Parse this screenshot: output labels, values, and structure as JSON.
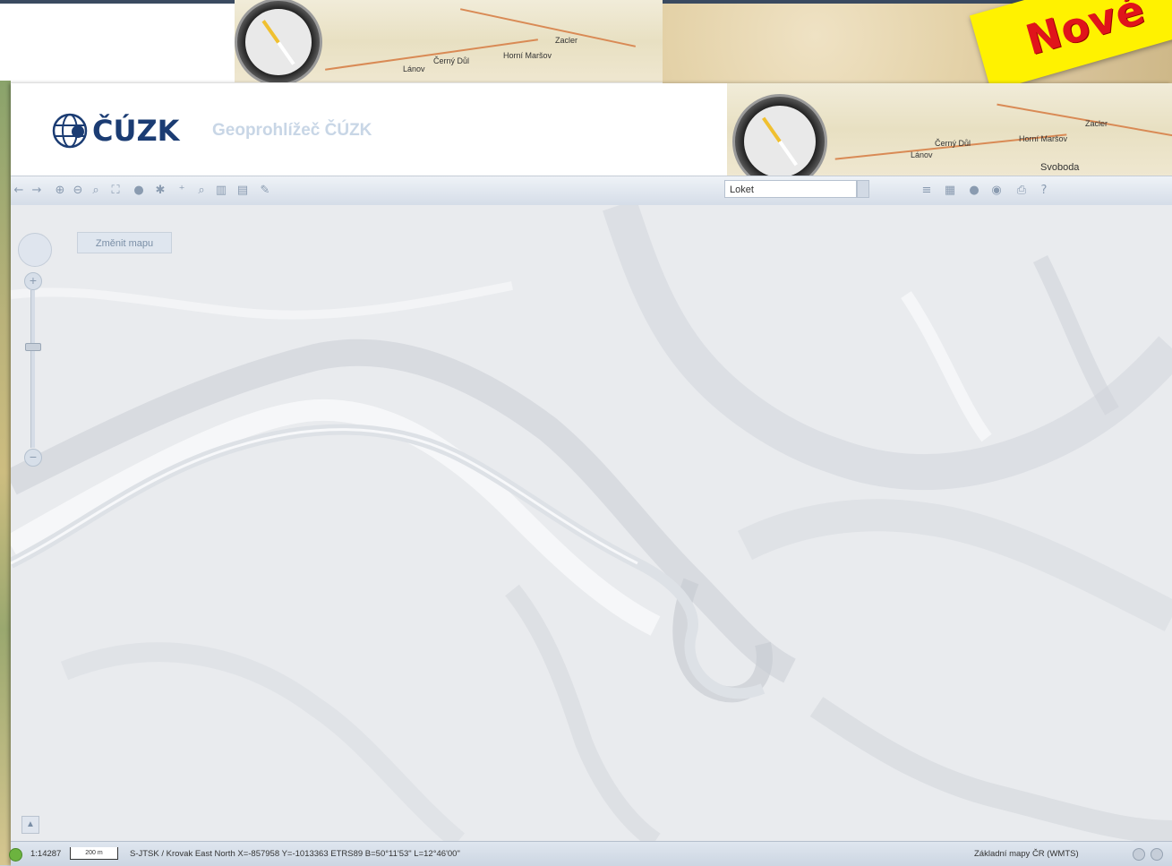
{
  "badge": {
    "text": "Nové"
  },
  "header": {
    "logo_text": "ČÚZK",
    "title": "Geoprohlížeč ČÚZK"
  },
  "map_labels": {
    "top": [
      "Lánov",
      "Černý Důl",
      "Horní Maršov",
      "Zacler"
    ],
    "header": [
      "Lánov",
      "Černý Důl",
      "Horní Maršov",
      "Zacler",
      "Svoboda"
    ]
  },
  "toolbar": {
    "search_value": "Loket",
    "left_icons": [
      "back-arrow-icon",
      "forward-arrow-icon",
      "zoom-in-icon",
      "zoom-out-icon",
      "zoom-box-icon",
      "full-extent-icon",
      "info-icon",
      "measure-icon",
      "coordinates-icon",
      "find-icon",
      "layers-icon",
      "print-icon",
      "settings-icon"
    ],
    "right_icons": [
      "list-icon",
      "grid-icon",
      "globe-icon",
      "legend-icon",
      "print-icon",
      "help-icon"
    ]
  },
  "map": {
    "change_map_label": "Změnit mapu"
  },
  "status": {
    "scale": "1:14287",
    "scalebar_label": "200 m",
    "coords": "S-JTSK / Krovak East North  X=-857958 Y=-1013363  ETRS89  B=50°11'53\" L=12°46'00\"",
    "layer": "Základní mapy ČR (WMTS)"
  }
}
